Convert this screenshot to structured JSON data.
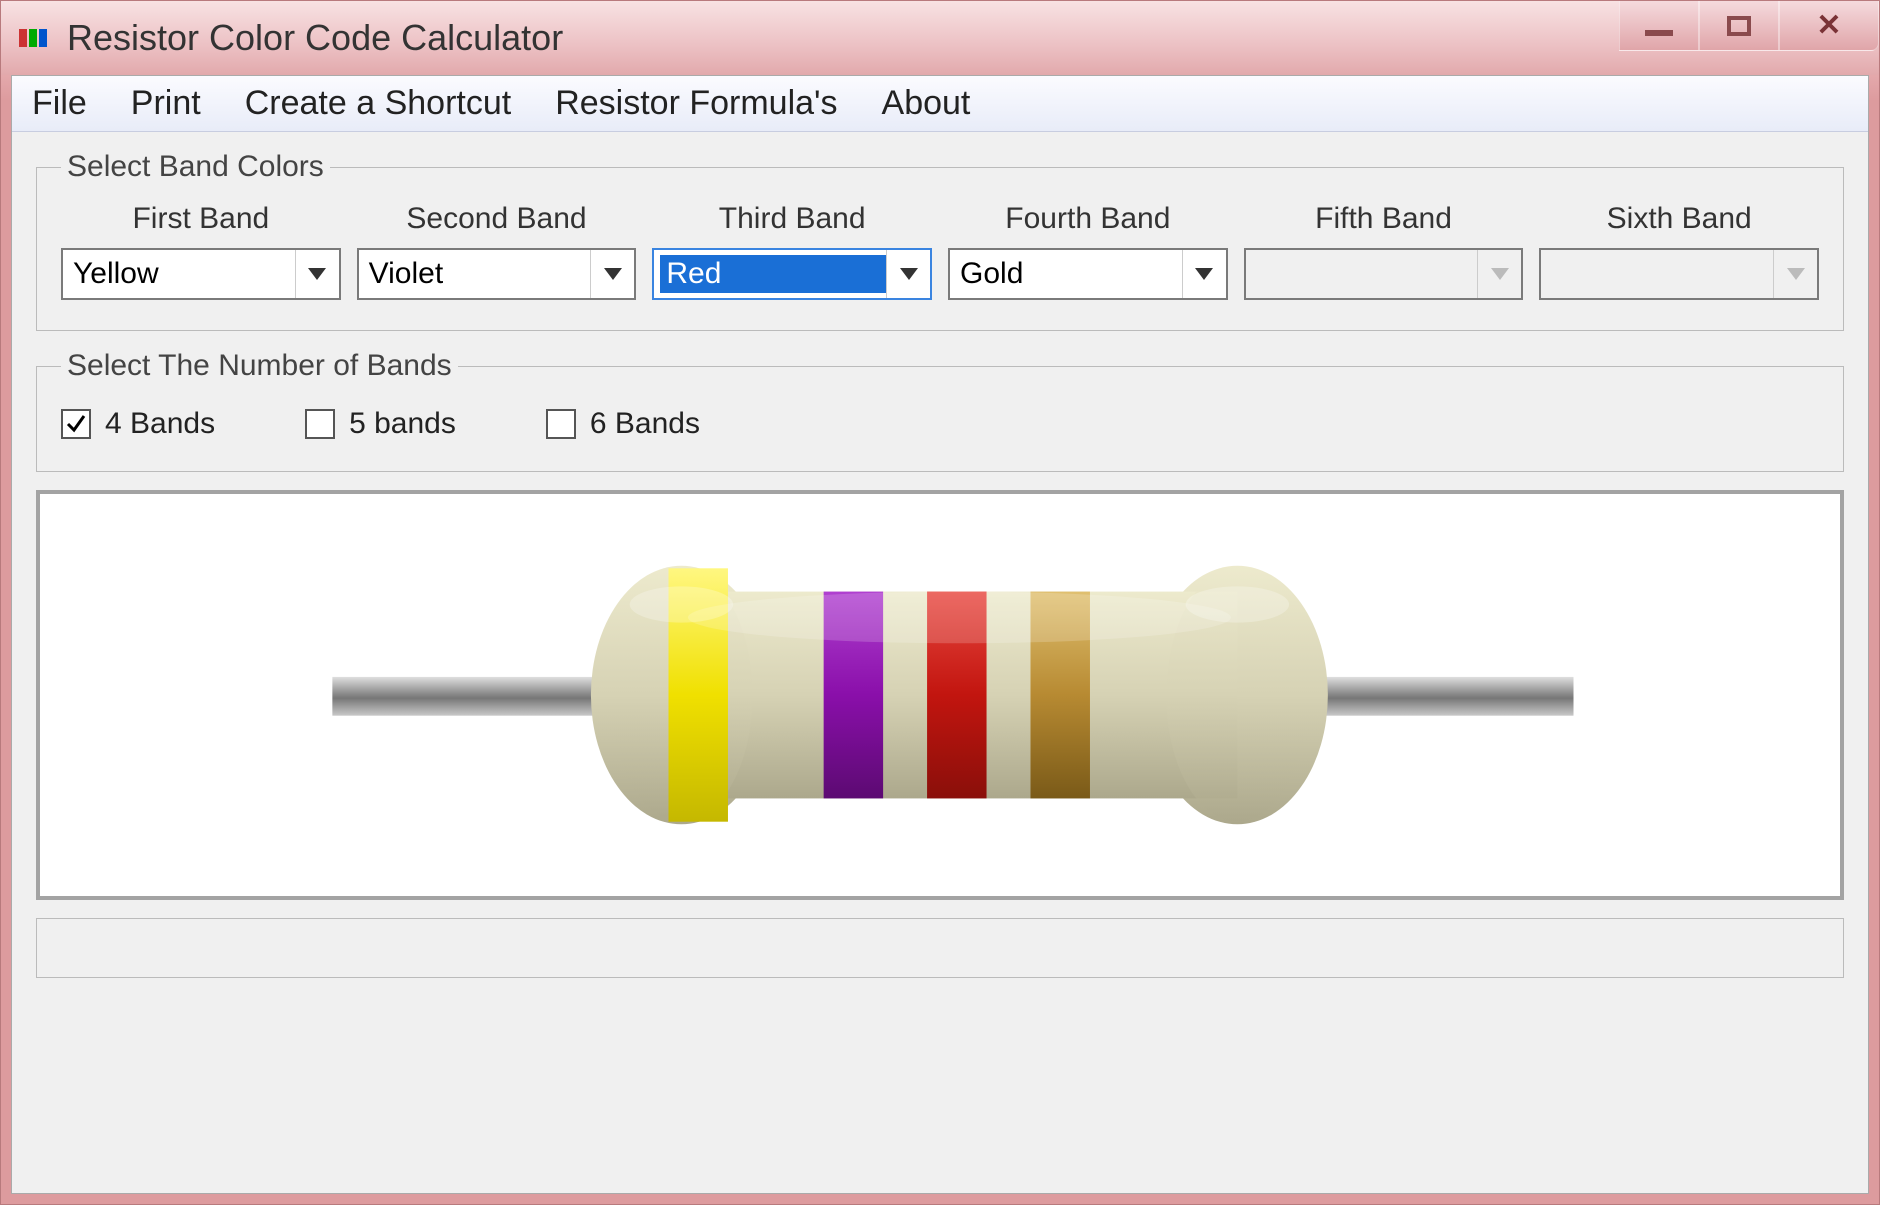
{
  "window": {
    "title": "Resistor Color Code Calculator"
  },
  "menu": {
    "items": [
      "File",
      "Print",
      "Create a Shortcut",
      "Resistor Formula's",
      "About"
    ]
  },
  "bandColors": {
    "legend": "Select Band Colors",
    "columns": [
      {
        "label": "First Band",
        "value": "Yellow",
        "enabled": true,
        "focused": false
      },
      {
        "label": "Second Band",
        "value": "Violet",
        "enabled": true,
        "focused": false
      },
      {
        "label": "Third Band",
        "value": "Red",
        "enabled": true,
        "focused": true
      },
      {
        "label": "Fourth Band",
        "value": "Gold",
        "enabled": true,
        "focused": false
      },
      {
        "label": "Fifth Band",
        "value": "",
        "enabled": false,
        "focused": false
      },
      {
        "label": "Sixth Band",
        "value": "",
        "enabled": false,
        "focused": false
      }
    ]
  },
  "numBands": {
    "legend": "Select The Number of Bands",
    "options": [
      {
        "label": "4 Bands",
        "checked": true
      },
      {
        "label": "5 bands",
        "checked": false
      },
      {
        "label": "6 Bands",
        "checked": false
      }
    ]
  },
  "resistor": {
    "bodyColor": "#d8d4b8",
    "leadColor": "#9a9a9a",
    "bands": [
      {
        "color": "#f5e000"
      },
      {
        "color": "#8a0faa"
      },
      {
        "color": "#c2150f"
      },
      {
        "color": "#b78a32"
      }
    ]
  }
}
